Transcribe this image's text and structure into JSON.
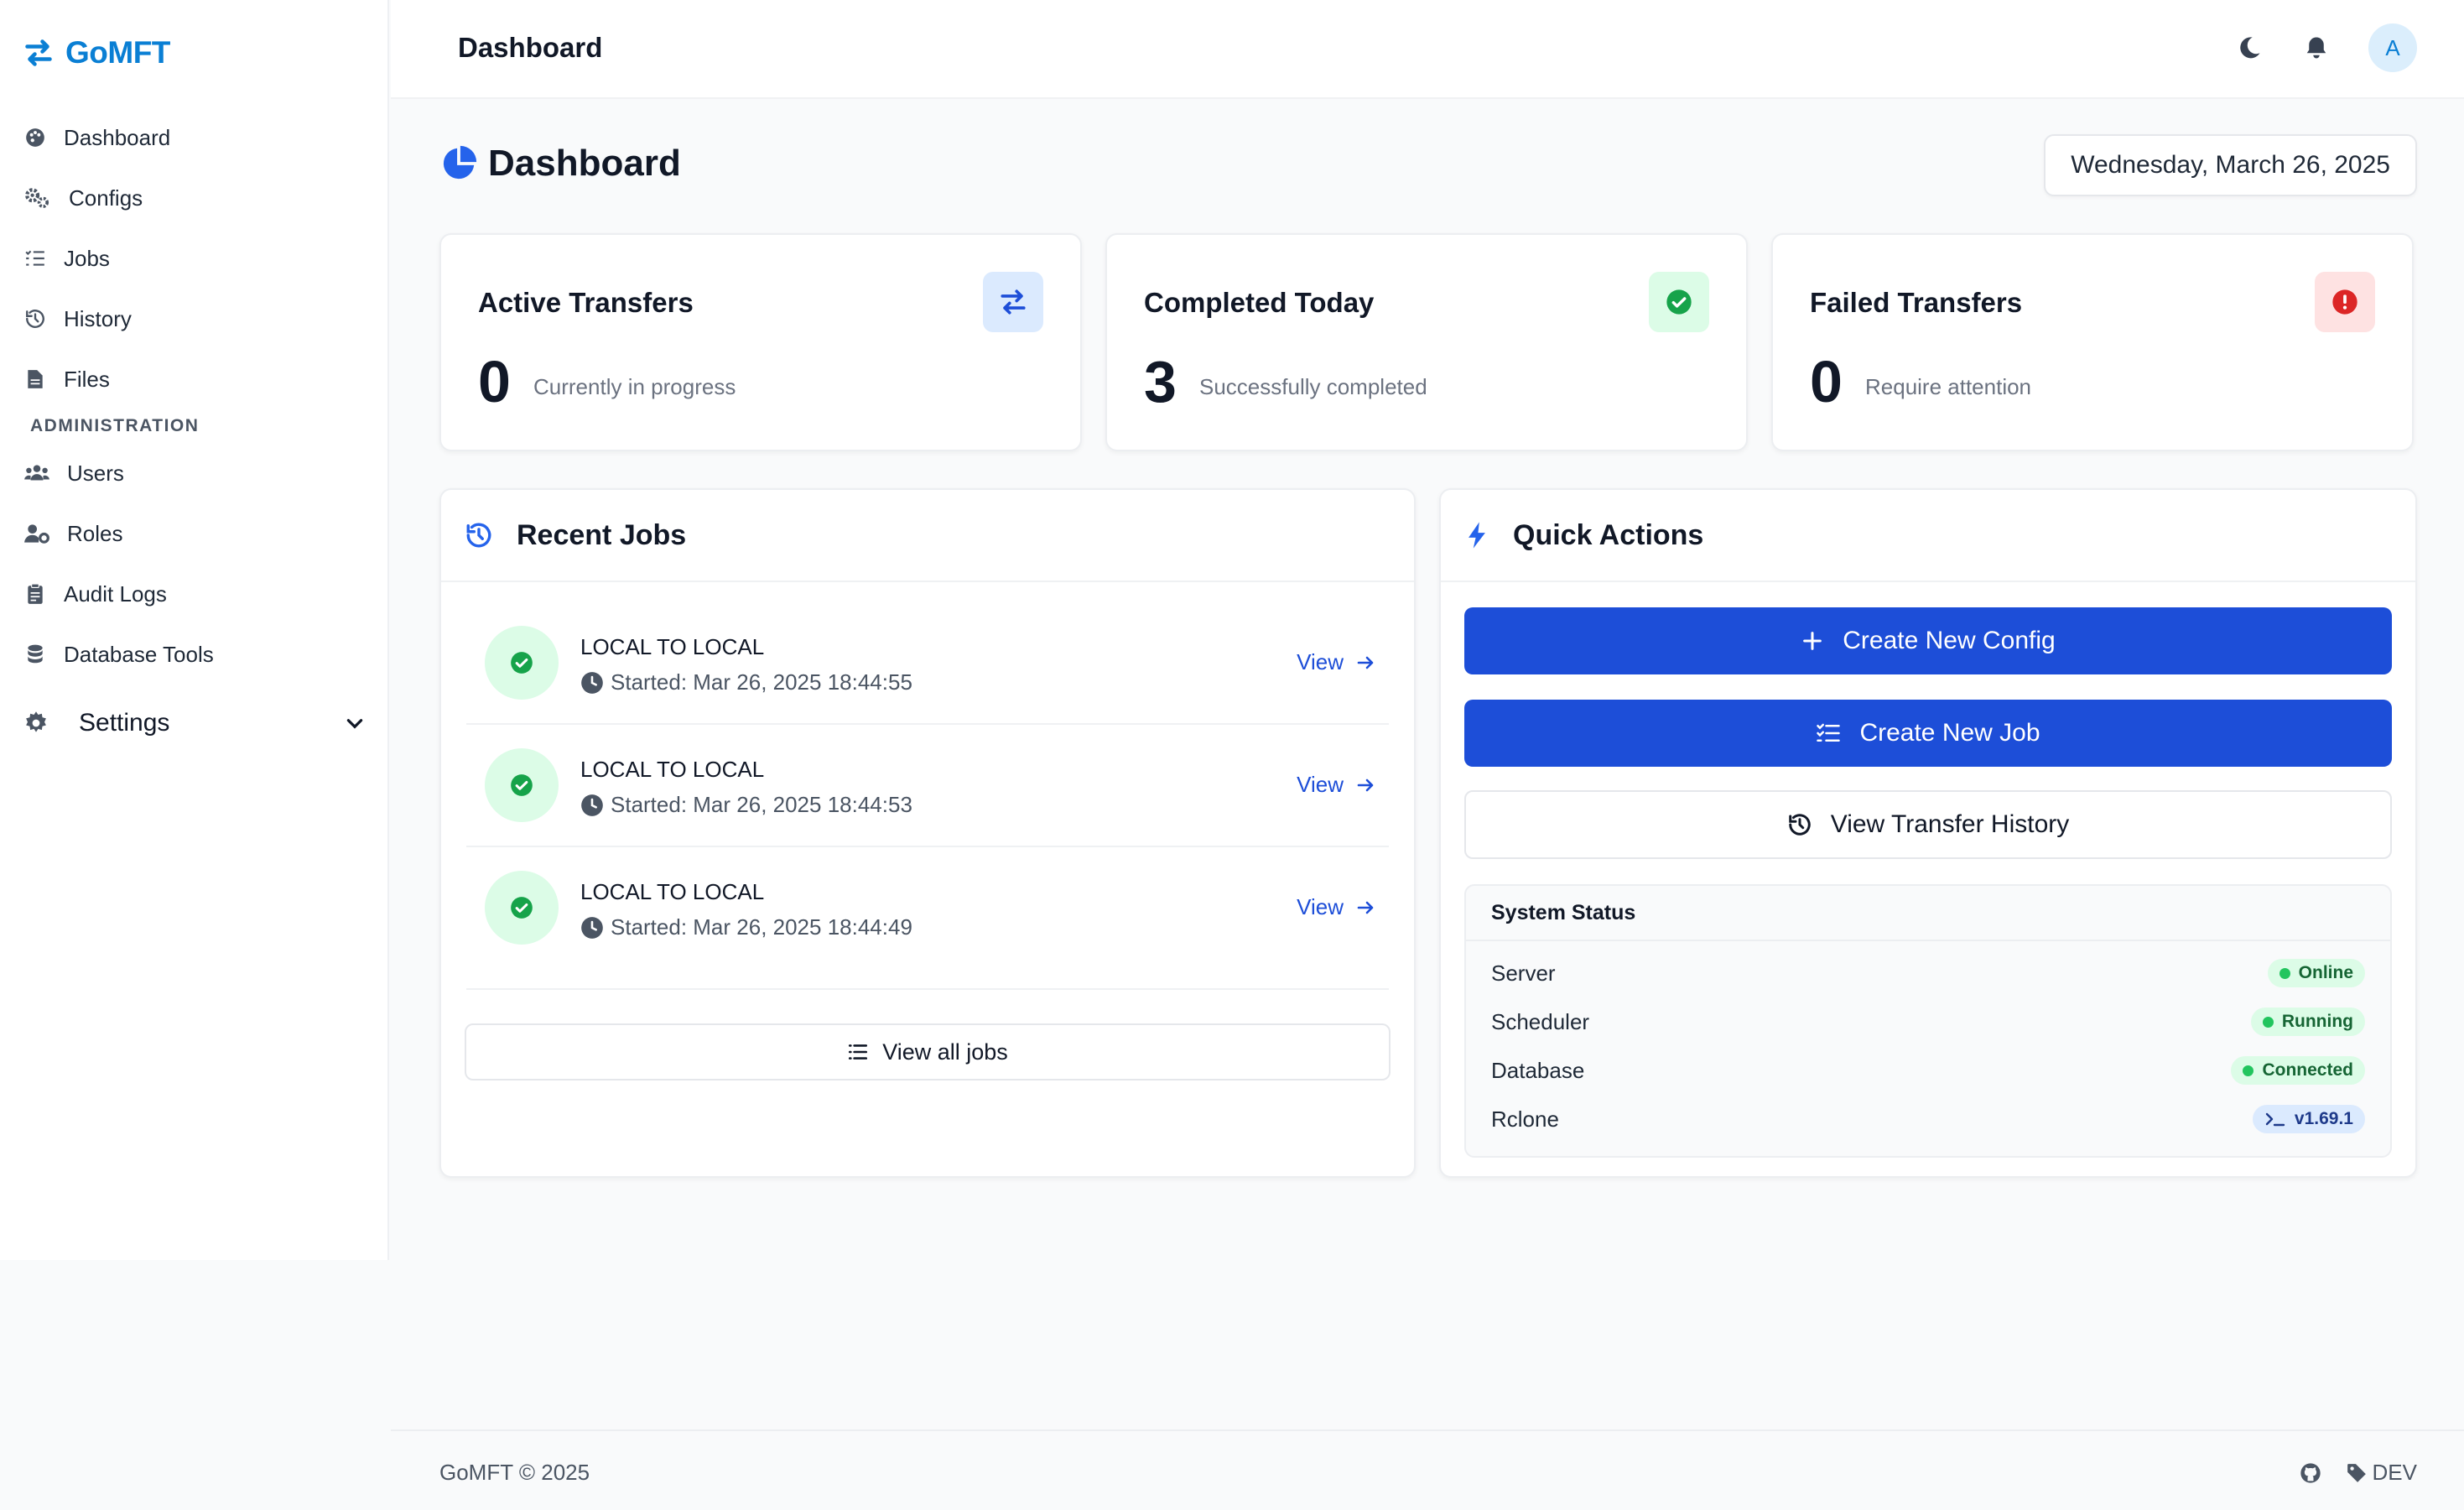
{
  "app": {
    "name": "GoMFT"
  },
  "sidebar": {
    "items": [
      {
        "label": "Dashboard",
        "icon": "palette-icon"
      },
      {
        "label": "Configs",
        "icon": "cogs-icon"
      },
      {
        "label": "Jobs",
        "icon": "tasks-icon"
      },
      {
        "label": "History",
        "icon": "history-icon"
      },
      {
        "label": "Files",
        "icon": "file-icon"
      }
    ],
    "section_admin": "ADMINISTRATION",
    "admin_items": [
      {
        "label": "Users",
        "icon": "users-icon"
      },
      {
        "label": "Roles",
        "icon": "user-cog-icon"
      },
      {
        "label": "Audit Logs",
        "icon": "clipboard-icon"
      },
      {
        "label": "Database Tools",
        "icon": "database-icon"
      }
    ],
    "settings": {
      "label": "Settings",
      "icon": "gear-icon"
    }
  },
  "header": {
    "title": "Dashboard",
    "avatar_initial": "A"
  },
  "main": {
    "title": "Dashboard",
    "date": "Wednesday, March 26, 2025",
    "stats": [
      {
        "title": "Active Transfers",
        "value": "0",
        "subtitle": "Currently in progress",
        "icon": "exchange-icon"
      },
      {
        "title": "Completed Today",
        "value": "3",
        "subtitle": "Successfully completed",
        "icon": "check-circle-icon"
      },
      {
        "title": "Failed Transfers",
        "value": "0",
        "subtitle": "Require attention",
        "icon": "exclamation-circle-icon"
      }
    ],
    "recent_jobs": {
      "title": "Recent Jobs",
      "jobs": [
        {
          "name": "LOCAL TO LOCAL",
          "started": "Started: Mar 26, 2025 18:44:55",
          "action": "View"
        },
        {
          "name": "LOCAL TO LOCAL",
          "started": "Started: Mar 26, 2025 18:44:53",
          "action": "View"
        },
        {
          "name": "LOCAL TO LOCAL",
          "started": "Started: Mar 26, 2025 18:44:49",
          "action": "View"
        }
      ],
      "view_all": "View all jobs"
    },
    "quick_actions": {
      "title": "Quick Actions",
      "create_config": "Create New Config",
      "create_job": "Create New Job",
      "view_history": "View Transfer History",
      "system_status": {
        "title": "System Status",
        "rows": [
          {
            "label": "Server",
            "value": "Online"
          },
          {
            "label": "Scheduler",
            "value": "Running"
          },
          {
            "label": "Database",
            "value": "Connected"
          },
          {
            "label": "Rclone",
            "value": "v1.69.1"
          }
        ]
      }
    }
  },
  "footer": {
    "copyright": "GoMFT © 2025",
    "env": "DEV"
  },
  "colors": {
    "brand": "#0a7fd4",
    "primary_button": "#1d4ed8",
    "success": "#16a34a",
    "danger": "#dc2626"
  }
}
